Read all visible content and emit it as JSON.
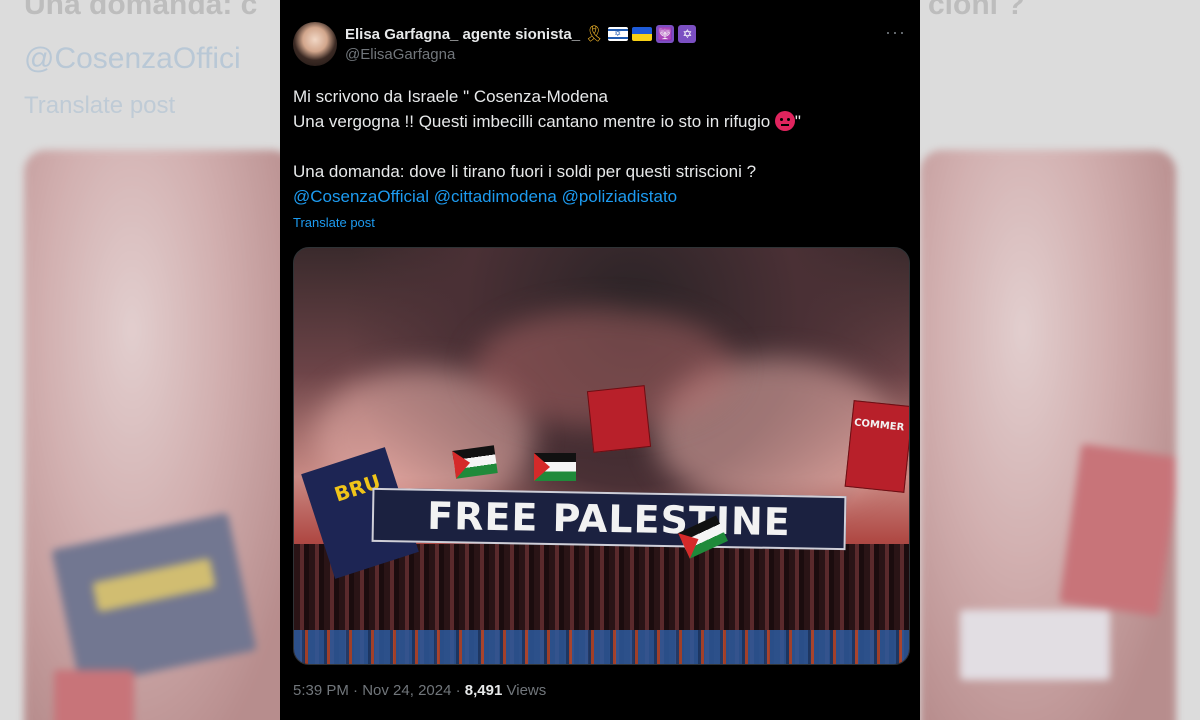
{
  "background": {
    "heading_left": "Una domanda: c",
    "heading_right": "cioni ?",
    "mention": "@CosenzaOffici",
    "translate": "Translate post"
  },
  "tweet": {
    "display_name": "Elisa Garfagna_ agente sionista_",
    "name_badges": [
      "yellow-ribbon-icon",
      "israel-flag-icon",
      "ukraine-flag-icon",
      "menorah-icon",
      "star-of-david-icon"
    ],
    "handle": "@ElisaGarfagna",
    "more_icon": "more-options-icon",
    "text_lines": [
      "Mi scrivono da Israele \" Cosenza-Modena",
      "Una vergogna !! Questi imbecilli   cantano mentre io sto in rifugio",
      "\"",
      "Una domanda: dove li tirano fuori i soldi per questi striscioni ?"
    ],
    "mentions": [
      "@CosenzaOfficial",
      "@cittadimodena",
      "@poliziadistato"
    ],
    "translate_label": "Translate post",
    "photo": {
      "banner_text": "FREE PALESTINE",
      "flag_text": "BRU",
      "side_flag_text": "COMMER"
    },
    "time": "5:39 PM",
    "separator": "·",
    "date": "Nov 24, 2024",
    "views_count": "8,491",
    "views_label": "Views"
  },
  "colors": {
    "card_bg": "#000000",
    "text": "#e7e9ea",
    "secondary": "#71767b",
    "link": "#1d9bf0"
  }
}
